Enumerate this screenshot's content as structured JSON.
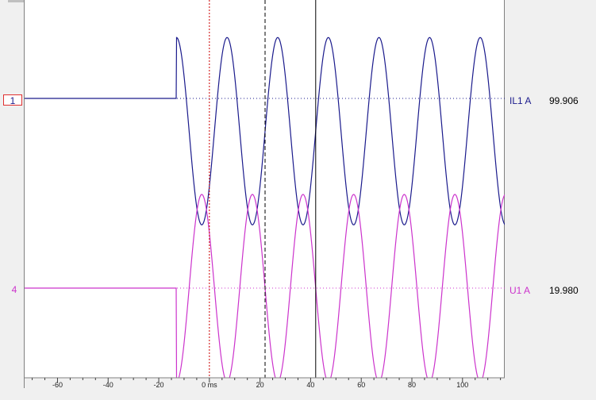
{
  "chart_data": {
    "type": "line",
    "x_unit": "ms",
    "xlim": [
      -73,
      117
    ],
    "x_ticks": [
      -60,
      -40,
      -20,
      0,
      20,
      40,
      60,
      80,
      100
    ],
    "x_tick_labels": [
      "-60",
      "-40",
      "-20",
      "0 ms",
      "20",
      "40",
      "60",
      "80",
      "100"
    ],
    "cursors": [
      {
        "x": 0,
        "style": "dashed",
        "color": "#cc0000"
      },
      {
        "x": 22,
        "style": "dashed",
        "color": "#000000"
      },
      {
        "x": 42,
        "style": "solid",
        "color": "#000000"
      }
    ],
    "series": [
      {
        "name": "IL1 A",
        "channel_number": "1",
        "value": "99.906",
        "color": "#1a1a8c",
        "pre_fault_level": 0,
        "fault_start_ms": -13,
        "fault_frequency_hz": 50,
        "fault_offset": -0.35,
        "fault_amplitude": 1.0,
        "fault_phase_deg": 180
      },
      {
        "name": "U1 A",
        "channel_number": "4",
        "value": "19.980",
        "color": "#cc33cc",
        "pre_fault_level": 0,
        "fault_start_ms": -13,
        "fault_frequency_hz": 50,
        "fault_offset": 0.0,
        "fault_amplitude": 1.0,
        "fault_phase_deg": 0
      }
    ],
    "grid": false
  }
}
